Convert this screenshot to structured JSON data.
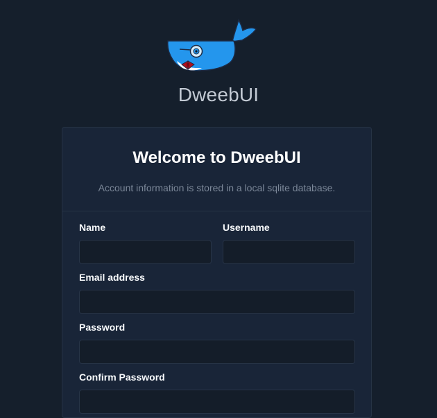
{
  "brand": {
    "name": "DweebUI",
    "logo_icon": "docker-whale-mascot-icon",
    "whale_color": "#2496ed",
    "bowtie_color": "#b0101e"
  },
  "card": {
    "title": "Welcome to DweebUI",
    "subtitle": "Account information is stored in a local sqlite database."
  },
  "form": {
    "name": {
      "label": "Name",
      "value": "",
      "placeholder": ""
    },
    "username": {
      "label": "Username",
      "value": "",
      "placeholder": ""
    },
    "email": {
      "label": "Email address",
      "value": "",
      "placeholder": ""
    },
    "password": {
      "label": "Password",
      "value": "",
      "placeholder": ""
    },
    "confirm_password": {
      "label": "Confirm Password",
      "value": "",
      "placeholder": ""
    }
  },
  "colors": {
    "background": "#151f2c",
    "card": "#192538",
    "input": "#141d29",
    "border": "#263345"
  }
}
